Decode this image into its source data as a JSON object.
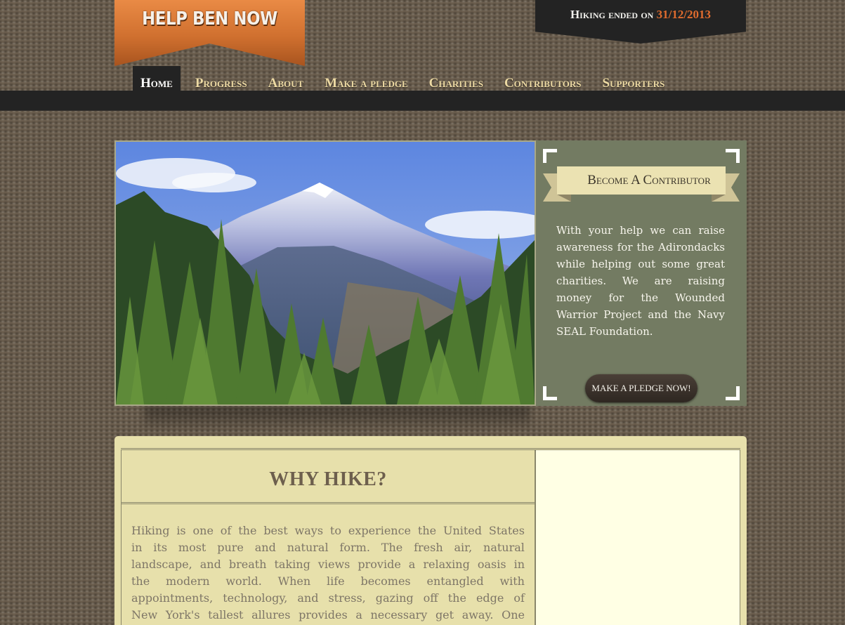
{
  "header": {
    "logo_text": "HELP BEN NOW",
    "status_prefix": "Hiking ended on",
    "status_date": "31/12/2013"
  },
  "nav": {
    "items": [
      {
        "label": "Home",
        "active": true
      },
      {
        "label": "Progress"
      },
      {
        "label": "About"
      },
      {
        "label": "Make a pledge"
      },
      {
        "label": "Charities"
      },
      {
        "label": "Contributors"
      },
      {
        "label": "Supporters"
      }
    ]
  },
  "hero": {
    "image_description": "Snow-dusted mountain above evergreen forest, blue sky"
  },
  "contributor": {
    "title": "Become A Contributor",
    "text": "With your help we can raise awareness for the Adirondacks while helping out some great charities. We are raising money for the Wounded Warrior Project and the Navy SEAL Foundation.",
    "button_label": "MAKE A PLEDGE NOW!"
  },
  "why_hike": {
    "heading": "WHY HIKE?",
    "lines": [
      "Hiking is one of the best ways to experience the United States",
      "in its most pure and natural form. The fresh air, natural",
      "landscape, and breath taking views provide a relaxing oasis in",
      "the modern world. When life becomes entangled with",
      "appointments, technology, and stress, gazing off the edge of",
      "New York's tallest allures provides a necessary get away. One"
    ]
  },
  "colors": {
    "accent": "#e06c2e",
    "nav_text": "#ecd9a3",
    "panel_green": "#737b62",
    "content_bg": "#e7e0ab"
  }
}
